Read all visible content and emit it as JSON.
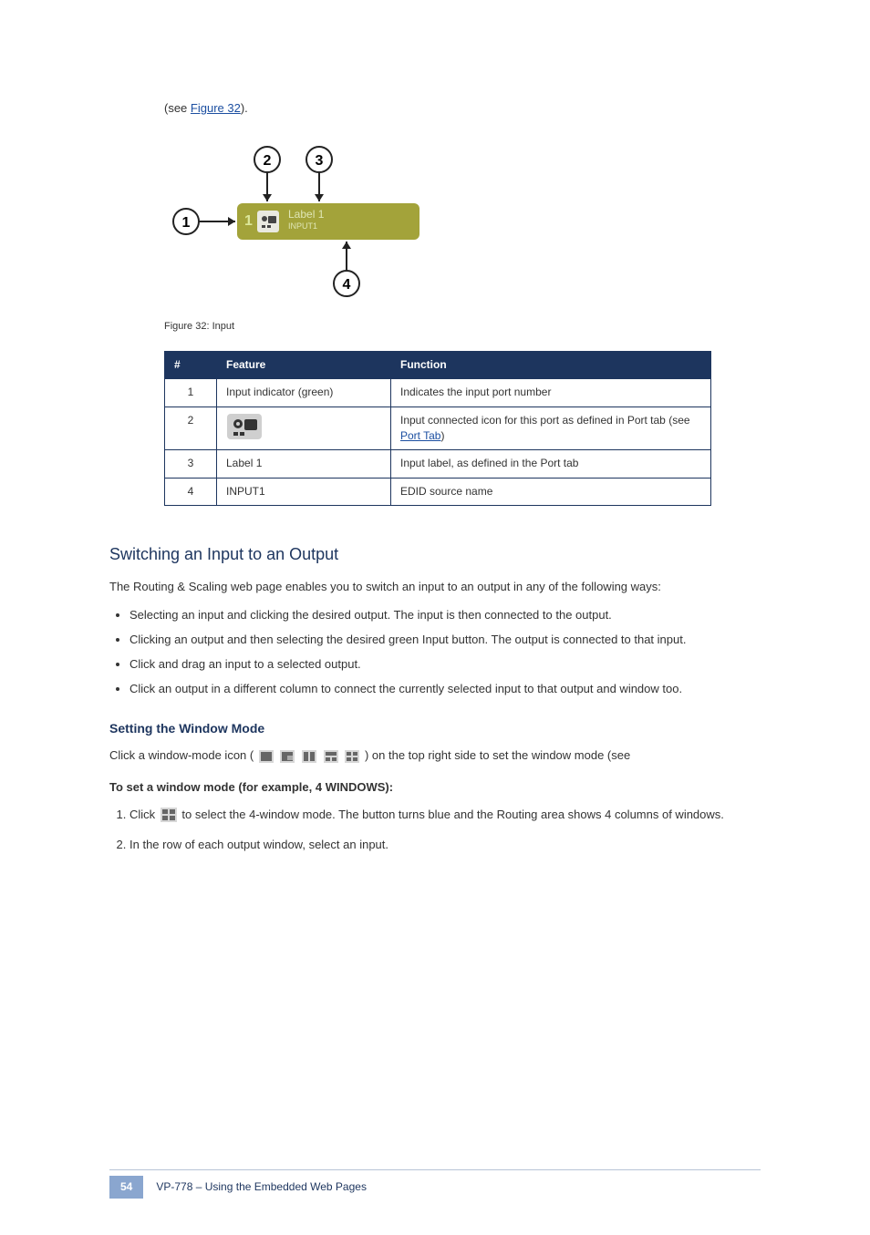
{
  "intro": {
    "pre_link": "(see ",
    "link_text": "Figure 32",
    "post_link": ")."
  },
  "figure": {
    "label_top": "Label 1",
    "label_bottom": "INPUT1",
    "box_number": "1",
    "callouts": {
      "c1": "1",
      "c2": "2",
      "c3": "3",
      "c4": "4"
    },
    "caption": "Figure 32: Input"
  },
  "table": {
    "headers": {
      "num": "#",
      "feature": "Feature",
      "function": "Function"
    },
    "rows": [
      {
        "num": "1",
        "feature": "Input indicator (green)",
        "function": "Indicates the input port number"
      },
      {
        "num": "2",
        "feature_is_icon": true,
        "function_pre": "Input connected icon for this port as defined in ",
        "function_link": "Port tab",
        "function_post_link": " (see ",
        "function_link2": "Port Tab",
        "function_tail": ")"
      },
      {
        "num": "3",
        "feature": "Label 1",
        "function": "Input label, as defined in the Port tab"
      },
      {
        "num": "4",
        "feature": "INPUT1",
        "function": "EDID source name"
      }
    ]
  },
  "section": {
    "heading": "Switching an Input to an Output",
    "intro": "The Routing & Scaling web page enables you to switch an input to an output in any of the following ways:",
    "bullets": [
      "Selecting an input and clicking the desired output.\nThe input is then connected to the output.",
      "Clicking an output and then selecting the desired green Input button.\nThe output is connected to that input.",
      "Click and drag an input to a selected output.",
      "Click an output in a different column to connect the currently selected input to that output and window too."
    ],
    "sub_heading": "Setting the Window Mode",
    "sub_intro_pre": "Click a window-mode icon (",
    "sub_intro_post": ") on the top right side to set the window mode (see "
  },
  "steps": {
    "lead_in": "To set a window mode (for example, 4 WINDOWS):",
    "items": [
      {
        "pre": "Click ",
        "icon": true,
        "post": " to select the 4-window mode. The button turns blue and the Routing area shows 4 columns of windows."
      },
      {
        "pre": "In the row of each output window, select an input.",
        "icon": false,
        "post": ""
      }
    ]
  },
  "footer": {
    "page_number": "54",
    "title": "VP-778 – Using the Embedded Web Pages"
  }
}
